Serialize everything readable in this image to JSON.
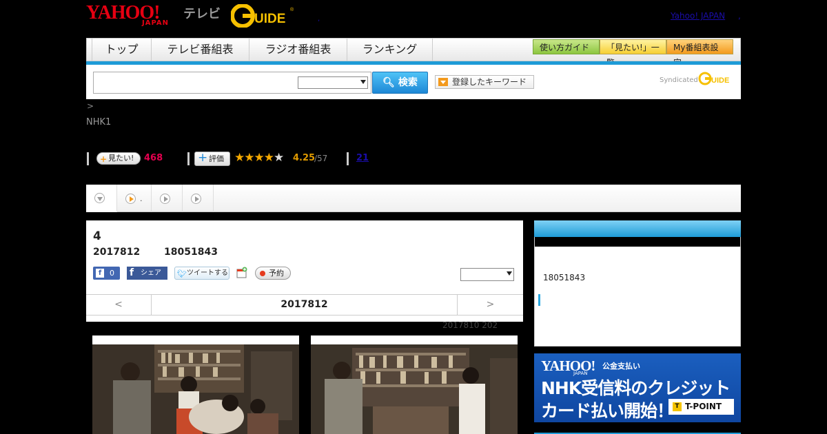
{
  "header": {
    "logo_yahoo": "YAHOO!",
    "logo_japan": "JAPAN",
    "logo_tv": "テレビ",
    "logo_gguide": "G-GUIDE",
    "top_link": "Yahoo! JAPAN",
    "top_link_sep": ",",
    "mid_dot": ","
  },
  "nav": {
    "tabs": [
      "トップ",
      "テレビ番組表",
      "ラジオ番組表",
      "ランキング"
    ],
    "buttons": [
      "使い方ガイド",
      "「見たい!」一覧",
      "My番組表設定"
    ]
  },
  "search": {
    "placeholder": "",
    "button_label": "検索",
    "keyword_button": "登録したキーワード",
    "syndicated": "Syndicated"
  },
  "program": {
    "breadcrumb": ">",
    "channel": "NHK1",
    "mitai_label": "見たい!",
    "mitai_count": "468",
    "rate_label": "評価",
    "rating": 4.25,
    "rating_text": "4.25",
    "rating_count": "/57",
    "review_count": "21"
  },
  "subtabs": [
    "",
    ".",
    "",
    ""
  ],
  "episode": {
    "title": "4",
    "date": "2017812",
    "time": "18051843",
    "fb_like_count": "0",
    "fb_share": "シェア",
    "tweet": "ツイートする",
    "reserve": "予約",
    "nav_prev": "<",
    "nav_date": "2017812",
    "nav_next": ">",
    "updated": "2017810  202"
  },
  "side": {
    "time": "18051843"
  },
  "banner": {
    "brand": "YAHOO!",
    "japan": "JAPAN",
    "subtitle": "公金支払い",
    "line1": "NHK受信料のクレジット",
    "line2": "カード払い開始！",
    "tpoint": "T-POINT",
    "tpoint_mark": "T"
  }
}
